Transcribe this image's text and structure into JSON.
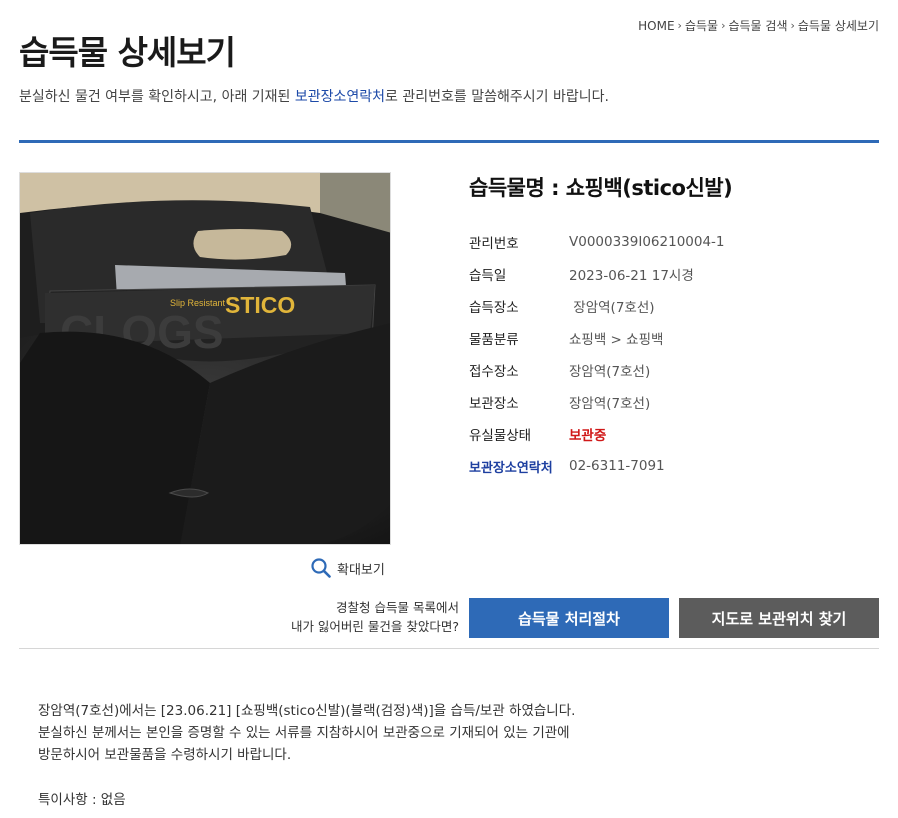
{
  "breadcrumb": [
    "HOME",
    "습득물",
    "습득물 검색",
    "습득물 상세보기"
  ],
  "page_title": "습득물 상세보기",
  "intro": {
    "before": "분실하신 물건 여부를 확인하시고, 아래 기재된 ",
    "highlight": "보관장소연락처",
    "after": "로 관리번호를 말씀해주시기 바랍니다."
  },
  "photo": {
    "brand_small": "Slip Resistant",
    "brand_big": "STICO",
    "brand_bg": "CLOGS"
  },
  "zoom_label": "확대보기",
  "item": {
    "title": "습득물명 : 쇼핑백(stico신발)",
    "fields": [
      {
        "label": "관리번호",
        "value": "V0000339I06210004-1"
      },
      {
        "label": "습득일",
        "value": "2023-06-21 17시경"
      },
      {
        "label": "습득장소",
        "value": " 장암역(7호선)"
      },
      {
        "label": "물품분류",
        "value": "쇼핑백 > 쇼핑백"
      },
      {
        "label": "접수장소",
        "value": "장암역(7호선)"
      },
      {
        "label": "보관장소",
        "value": "장암역(7호선)"
      },
      {
        "label": "유실물상태",
        "value": "보관중"
      },
      {
        "label": "보관장소연락처",
        "value": "02-6311-7091"
      }
    ]
  },
  "help_text": {
    "line1": "경찰청 습득물 목록에서",
    "line2": "내가 잃어버린 물건을 찾았다면?"
  },
  "buttons": {
    "process": "습득물 처리절차",
    "map": "지도로 보관위치 찾기"
  },
  "notice": {
    "line1": "장암역(7호선)에서는 [23.06.21] [쇼핑백(stico신발)(블랙(검정)색)]을 습득/보관 하였습니다.",
    "line2": "분실하신 분께서는 본인을 증명할 수 있는 서류를 지참하시어 보관중으로 기재되어 있는 기관에",
    "line3": "방문하시어 보관물품을 수령하시기 바랍니다."
  },
  "special": "특이사항 : 없음",
  "colors": {
    "accent": "#2e6ab7",
    "status_red": "#d01818",
    "label_blue": "#1d3fa0",
    "button_gray": "#5c5c5c"
  }
}
